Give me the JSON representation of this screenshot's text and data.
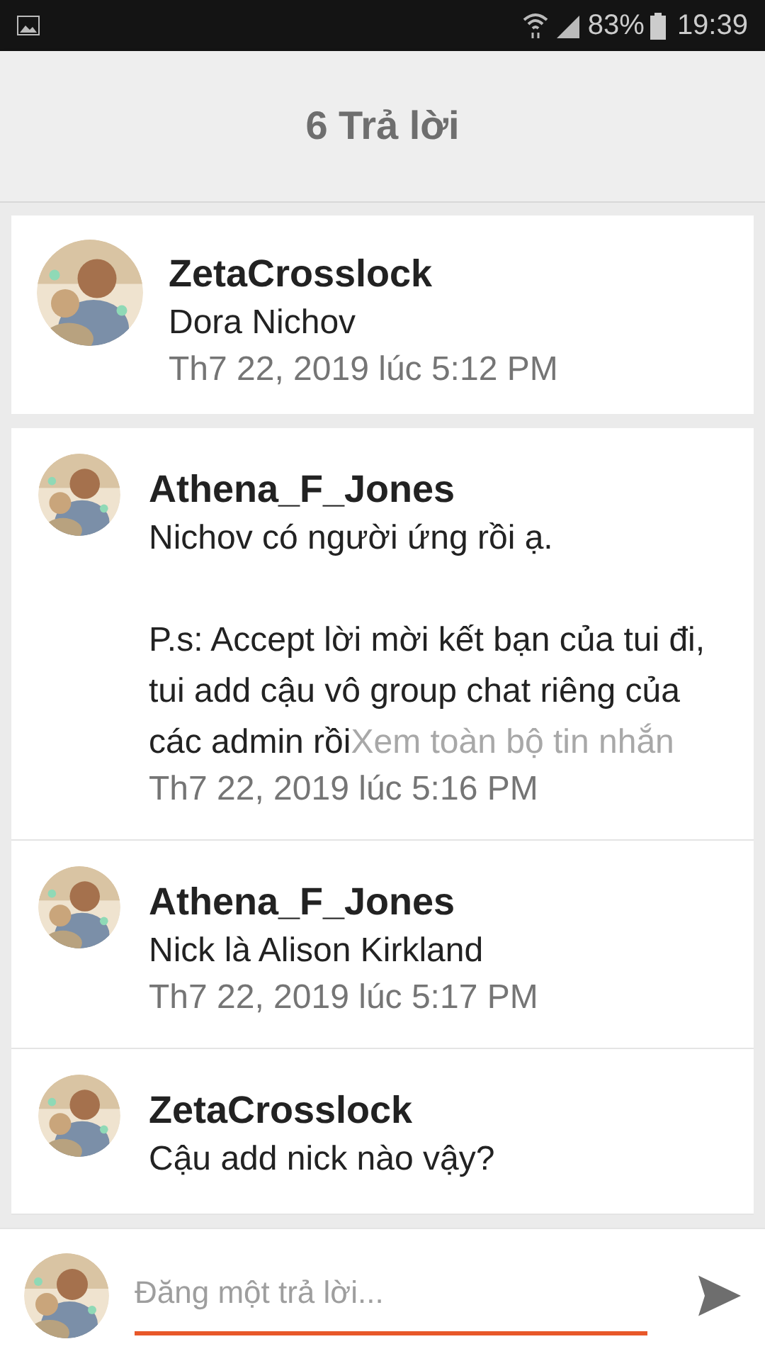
{
  "status_bar": {
    "battery": "83%",
    "time": "19:39"
  },
  "header": {
    "title": "6 Trả lời"
  },
  "post": {
    "author": "ZetaCrosslock",
    "text": "Dora Nichov",
    "time": "Th7 22, 2019 lúc 5:12 PM"
  },
  "replies": [
    {
      "author": "Athena_F_Jones",
      "text": "Nichov có người ứng rồi ạ.\n\nP.s: Accept lời mời kết bạn của tui đi, tui add cậu vô group chat riêng của các admin rồi",
      "more_link": "Xem toàn bộ tin nhắn",
      "time": "Th7 22, 2019 lúc 5:16 PM"
    },
    {
      "author": "Athena_F_Jones",
      "text": "Nick là Alison Kirkland",
      "time": "Th7 22, 2019 lúc 5:17 PM"
    },
    {
      "author": "ZetaCrosslock",
      "text": "Cậu add nick nào vậy?"
    }
  ],
  "composer": {
    "placeholder": "Đăng một trả lời..."
  }
}
